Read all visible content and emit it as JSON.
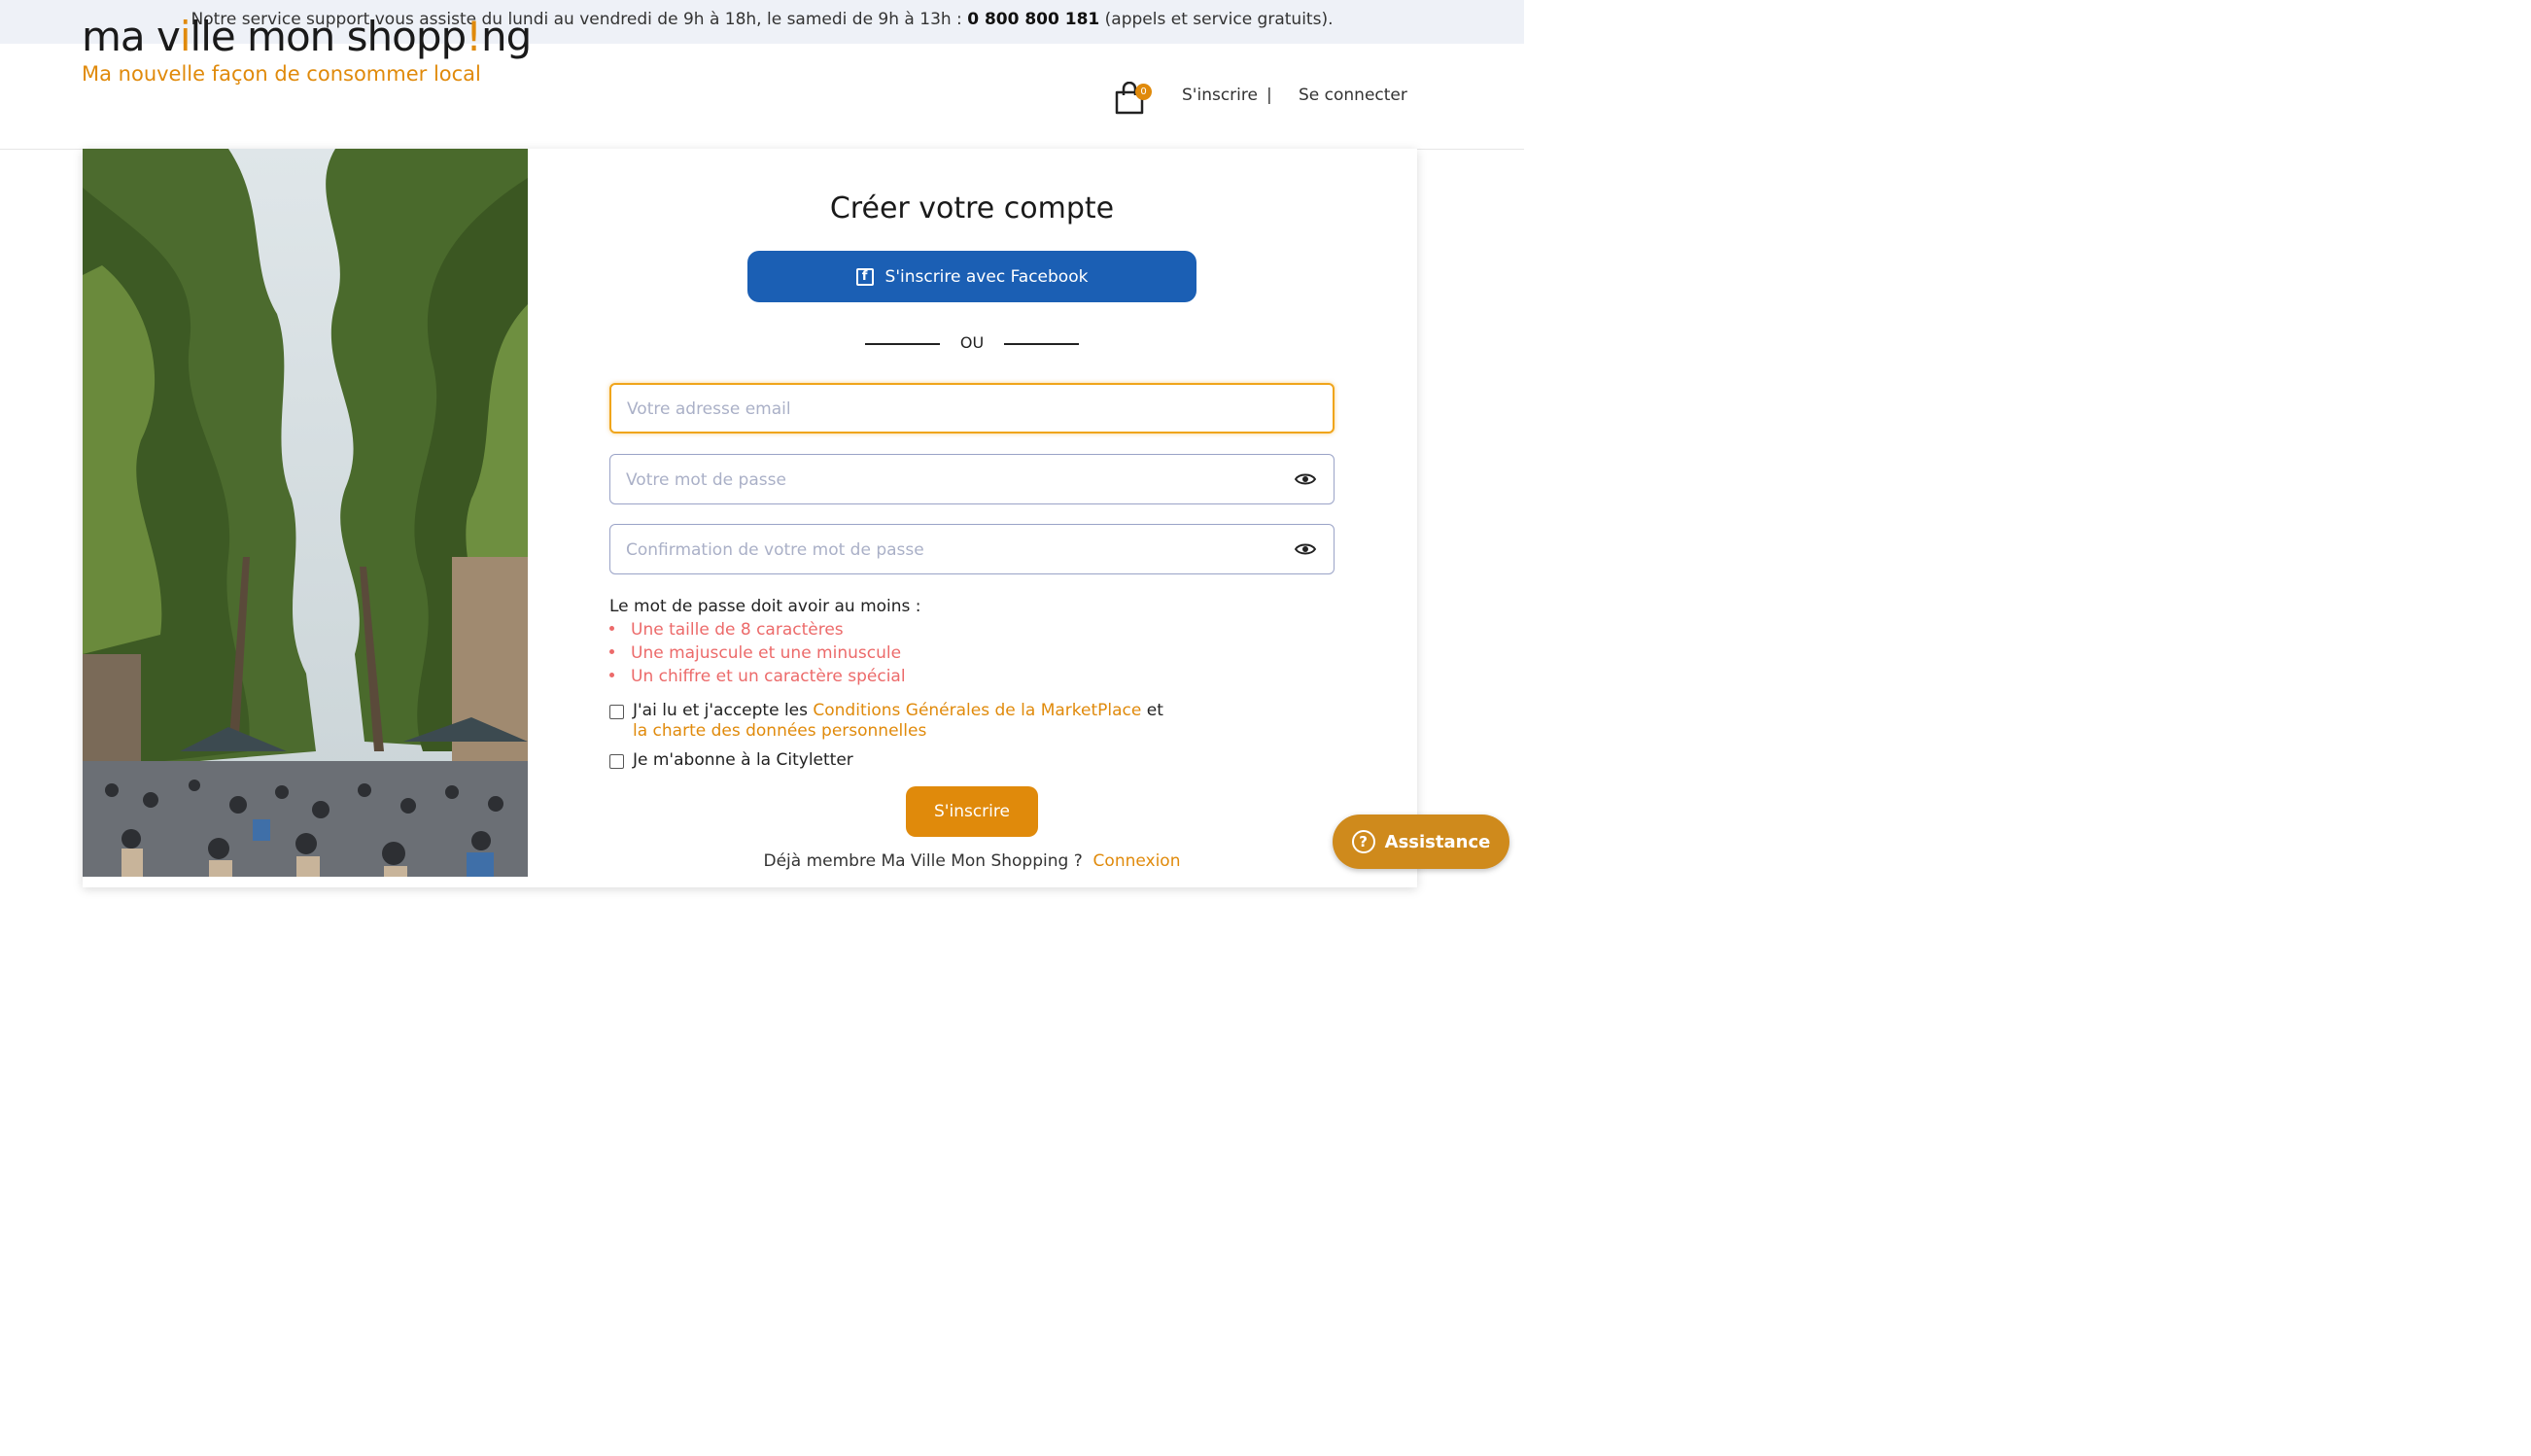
{
  "support_bar": {
    "text_before": "Notre service support vous assiste du lundi au vendredi de 9h à 18h, le samedi de 9h à 13h : ",
    "phone": "0 800 800 181",
    "text_after": " (appels et service gratuits)."
  },
  "header": {
    "logo_part1": "ma v",
    "logo_i": "i",
    "logo_part2": "lle mon shopp",
    "logo_excl": "!",
    "logo_part3": "ng",
    "tagline": "Ma nouvelle façon de consommer local",
    "cart_count": "0",
    "signup_link": "S'inscrire",
    "separator": "|",
    "login_link": "Se connecter"
  },
  "form": {
    "title": "Créer votre compte",
    "facebook_button": "S'inscrire avec Facebook",
    "facebook_icon_letter": "f",
    "or_label": "OU",
    "email_placeholder": "Votre adresse email",
    "password_placeholder": "Votre mot de passe",
    "confirm_placeholder": "Confirmation de votre mot de passe",
    "rules_title": "Le mot de passe doit avoir au moins :",
    "rules": [
      "Une taille de 8 caractères",
      "Une majuscule et une minuscule",
      "Un chiffre et un caractère spécial"
    ],
    "terms_prefix": "J'ai lu et j'accepte les ",
    "terms_link": "Conditions Générales de la MarketPlace",
    "terms_middle": " et",
    "privacy_link": "la charte des données personnelles",
    "newsletter_label": "Je m'abonne à la Cityletter",
    "submit_button": "S'inscrire",
    "already_member": "Déjà membre Ma Ville Mon Shopping ?",
    "login_link": "Connexion"
  },
  "assistance": {
    "label": "Assistance",
    "icon_char": "?"
  },
  "colors": {
    "accent_orange": "#e08a0b",
    "facebook_blue": "#1b5fb4",
    "rule_red": "#ec6a6a",
    "support_bar_bg": "#eef1f7"
  },
  "icons": [
    "cart-icon",
    "facebook-icon",
    "eye-icon",
    "help-icon"
  ]
}
